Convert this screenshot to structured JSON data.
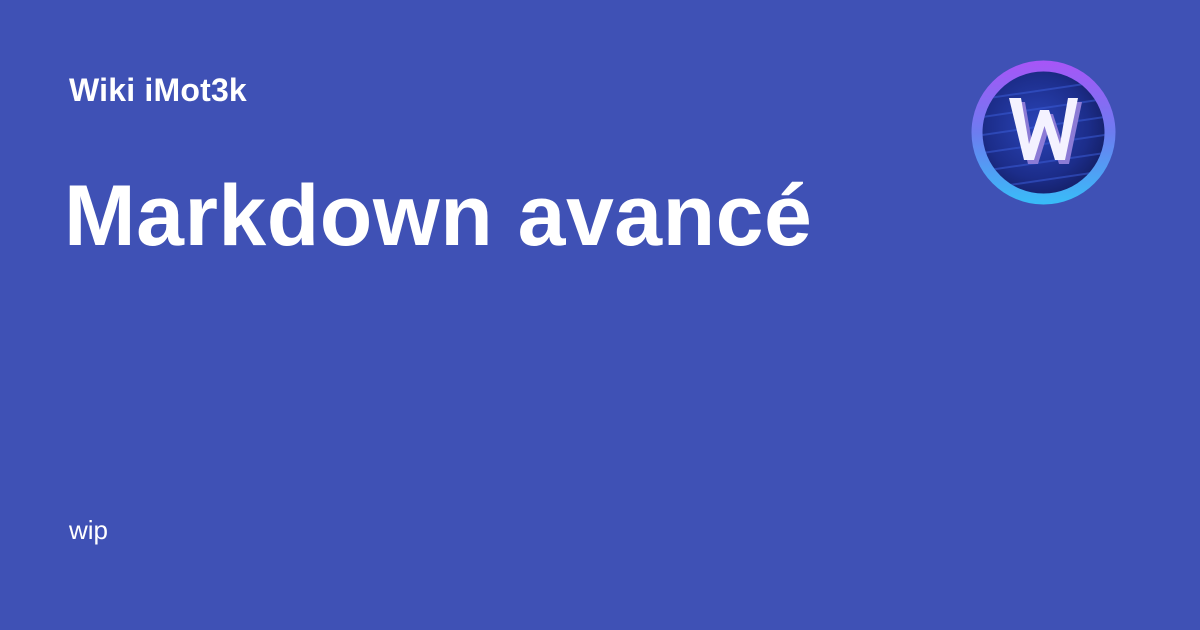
{
  "card": {
    "site_name": "Wiki iMot3k",
    "title": "Markdown avancé",
    "description": "wip",
    "background_color": "#3f51b5",
    "text_color": "#ffffff"
  },
  "logo": {
    "icon": "w-logo-icon",
    "letter": "W",
    "ring_colors": [
      "#8b5cf6",
      "#38bdf8"
    ],
    "inner_color": "#1e2f8f"
  }
}
